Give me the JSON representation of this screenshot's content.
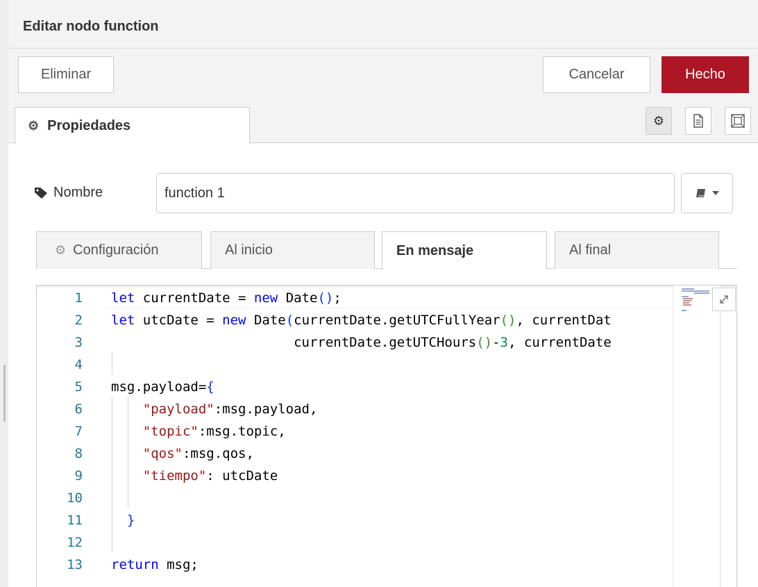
{
  "title": "Editar nodo function",
  "buttons": {
    "delete": "Eliminar",
    "cancel": "Cancelar",
    "done": "Hecho"
  },
  "colors": {
    "done_bg": "#ad1625",
    "line_number": "#237893",
    "keyword": "#0000ff",
    "string": "#a31515",
    "number": "#098658"
  },
  "tabs": {
    "properties": "Propiedades"
  },
  "icons": {
    "properties_tab": "gear-icon",
    "settings": "gear-icon",
    "description": "document-icon",
    "appearance": "layout-frame-icon",
    "name_label": "tag-icon",
    "name_library": "book-icon",
    "expand": "expand-icon"
  },
  "name_field": {
    "label": "Nombre",
    "value": "function 1"
  },
  "subtabs": [
    {
      "label": "Configuración",
      "active": false
    },
    {
      "label": "Al inicio",
      "active": false
    },
    {
      "label": "En mensaje",
      "active": true
    },
    {
      "label": "Al final",
      "active": false
    }
  ],
  "code": {
    "lines": [
      {
        "n": "1",
        "text": "let currentDate = new Date();"
      },
      {
        "n": "2",
        "text": "let utcDate = new Date(currentDate.getUTCFullYear(), currentDat"
      },
      {
        "n": "3",
        "text": "                       currentDate.getUTCHours()-3, currentDate"
      },
      {
        "n": "4",
        "text": ""
      },
      {
        "n": "5",
        "text": "msg.payload={"
      },
      {
        "n": "6",
        "text": "    \"payload\":msg.payload,"
      },
      {
        "n": "7",
        "text": "    \"topic\":msg.topic,"
      },
      {
        "n": "8",
        "text": "    \"qos\":msg.qos,"
      },
      {
        "n": "9",
        "text": "    \"tiempo\": utcDate"
      },
      {
        "n": "10",
        "text": ""
      },
      {
        "n": "11",
        "text": "  }"
      },
      {
        "n": "12",
        "text": ""
      },
      {
        "n": "13",
        "text": "return msg;"
      }
    ]
  }
}
